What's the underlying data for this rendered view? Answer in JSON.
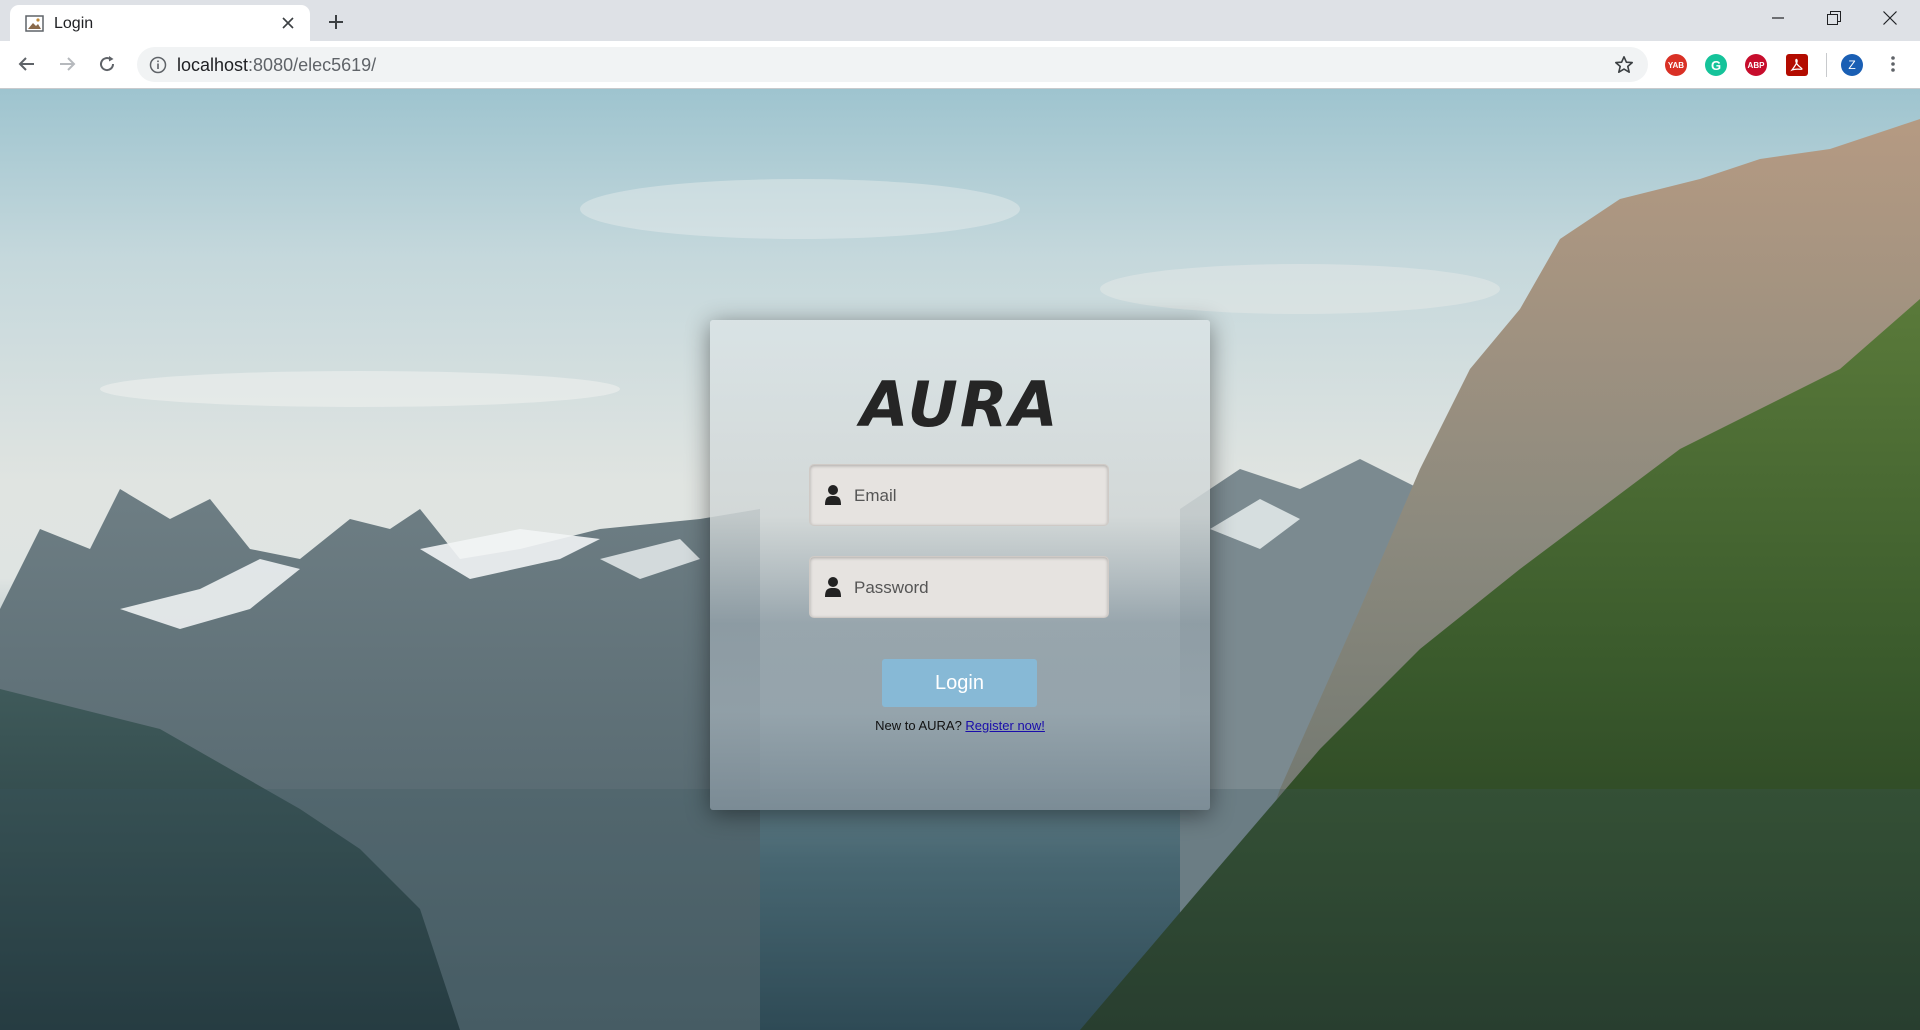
{
  "browser": {
    "tab_title": "Login",
    "url_host": "localhost",
    "url_path": ":8080/elec5619/",
    "extensions": [
      {
        "name": "yab-extension-icon",
        "label": "YAB",
        "color": "#d93025"
      },
      {
        "name": "grammarly-extension-icon",
        "label": "G",
        "color": "#15c39a"
      },
      {
        "name": "adblock-extension-icon",
        "label": "ABP",
        "color": "#c70d2c"
      },
      {
        "name": "acrobat-extension-icon",
        "label": "",
        "color": "#b30b00"
      }
    ],
    "profile_initial": "Z"
  },
  "login": {
    "logo_text": "AURA",
    "email_placeholder": "Email",
    "password_placeholder": "Password",
    "button_label": "Login",
    "register_prompt": "New to AURA? ",
    "register_link": "Register now!",
    "accent_color": "#87b9d6"
  }
}
